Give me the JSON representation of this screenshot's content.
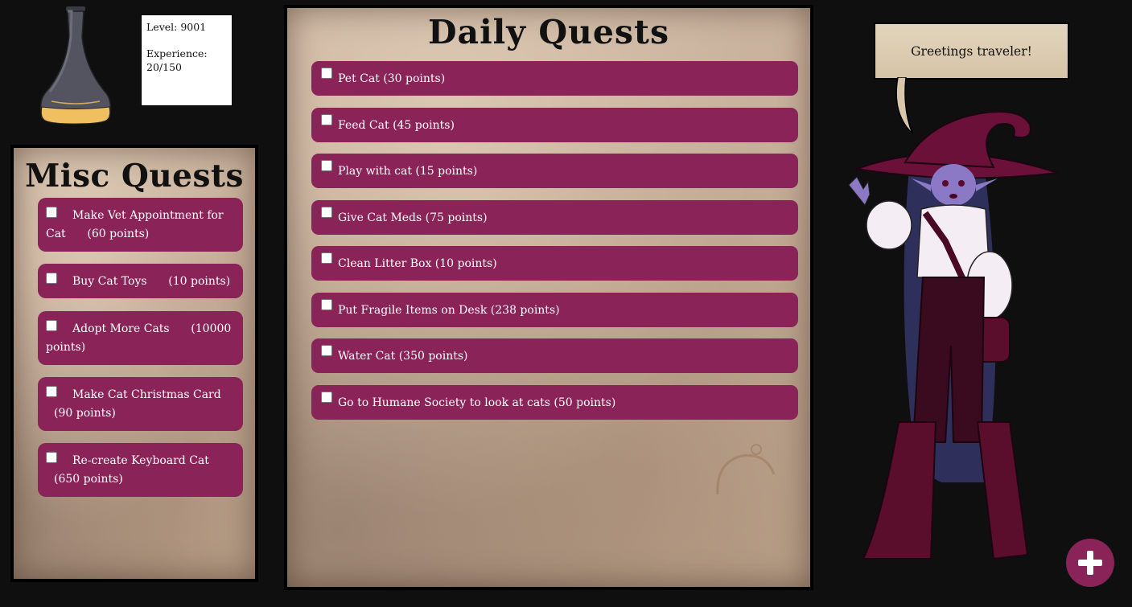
{
  "player": {
    "level_text": "Level: 9001",
    "experience_label": "Experience:",
    "experience_value": "20/150",
    "experience_fraction": 0.1333
  },
  "misc": {
    "title": "Misc Quests",
    "items": [
      {
        "line1": "Make Vet Appointment for",
        "line2": "Cat      (60 points)"
      },
      {
        "line1": "Buy Cat Toys      (10 points)",
        "line2": ""
      },
      {
        "line1": "Adopt More Cats      (10000",
        "line2": "points)"
      },
      {
        "line1": "Make Cat Christmas Card",
        "line2": "(90 points)"
      },
      {
        "line1": "Re-create Keyboard Cat",
        "line2": "(650 points)"
      }
    ]
  },
  "daily": {
    "title": "Daily Quests",
    "items": [
      {
        "label": "Pet Cat (30 points)"
      },
      {
        "label": "Feed Cat (45 points)"
      },
      {
        "label": "Play with cat (15 points)"
      },
      {
        "label": "Give Cat Meds (75 points)"
      },
      {
        "label": "Clean Litter Box (10 points)"
      },
      {
        "label": "Put Fragile Items on Desk (238 points)"
      },
      {
        "label": "Water Cat (350 points)"
      },
      {
        "label": "Go to Humane Society to look at cats (50 points)"
      }
    ]
  },
  "npc": {
    "greeting": "Greetings traveler!"
  },
  "colors": {
    "quest_item": "#8a2357",
    "background": "#0f0f0f",
    "potion_fill": "#f0c060",
    "potion_glass": "#4a4a58"
  },
  "icons": {
    "add": "plus-icon",
    "potion": "experience-potion-icon"
  }
}
